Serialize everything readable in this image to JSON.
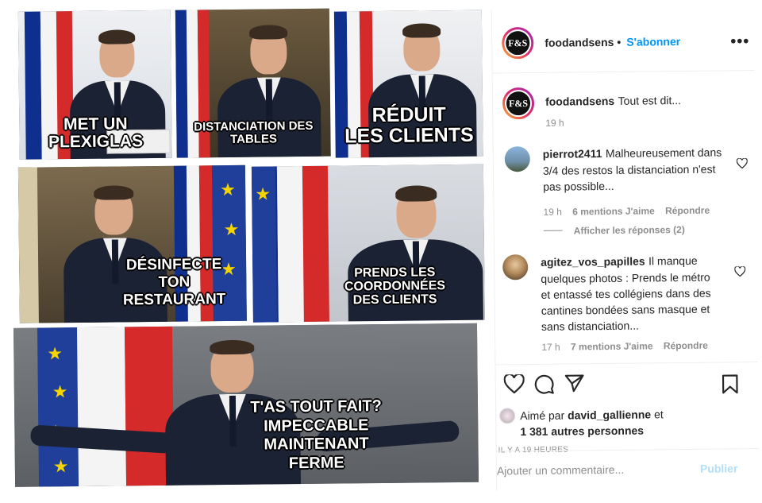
{
  "meme": {
    "panels": [
      {
        "caption": "MET UN\nPLEXIGLAS"
      },
      {
        "caption": "DISTANCIATION DES\nTABLES"
      },
      {
        "caption": "RÉDUIT\nLES CLIENTS"
      },
      {
        "caption": "DÉSINFECTE\nTON\nRESTAURANT"
      },
      {
        "caption": "PRENDS LES\nCOORDONNÉES\nDES CLIENTS"
      },
      {
        "caption": "T'AS TOUT FAIT?\nIMPECCABLE\nMAINTENANT\nFERME"
      }
    ],
    "colors": {
      "flag_blue": "#0f2f8f",
      "flag_white": "#f4f4f4",
      "flag_red": "#d42a2a",
      "eu_blue": "#1f3f9a",
      "eu_star": "#f5d400"
    }
  },
  "header": {
    "avatar_text": "F&S",
    "username": "foodandsens",
    "separator": "•",
    "follow_label": "S'abonner",
    "more_icon": "more-horizontal-icon"
  },
  "caption_post": {
    "username": "foodandsens",
    "text": "Tout est dit...",
    "time": "19 h"
  },
  "comments": [
    {
      "username": "pierrot2411",
      "text_line1": "Malheureusement dans",
      "text_line2": "3/4 des restos la distanciation n'est",
      "text_line3": "pas possible...",
      "time": "19 h",
      "likes": "6 mentions J'aime",
      "reply": "Répondre",
      "view_replies": "Afficher les réponses (2)"
    },
    {
      "username": "agitez_vos_papilles",
      "text_line1": "Il manque",
      "text_line2": "quelques photos : Prends le métro",
      "text_line3": "et entassé tes collégiens dans des",
      "text_line4": "cantines bondées sans masque et",
      "text_line5": "sans distanciation...",
      "time": "17 h",
      "likes": "7 mentions J'aime",
      "reply": "Répondre"
    }
  ],
  "actions": {
    "like_icon": "heart-icon",
    "comment_icon": "comment-icon",
    "share_icon": "paper-plane-icon",
    "save_icon": "bookmark-icon",
    "liked_by_prefix": "Aimé par",
    "liked_by_user": "david_gallienne",
    "liked_by_and": "et",
    "liked_by_others": "1 381 autres personnes",
    "timestamp": "IL Y A 19 HEURES"
  },
  "comment_input": {
    "placeholder": "Ajouter un commentaire...",
    "publish_label": "Publier",
    "publish_color": "#b2dffc"
  }
}
